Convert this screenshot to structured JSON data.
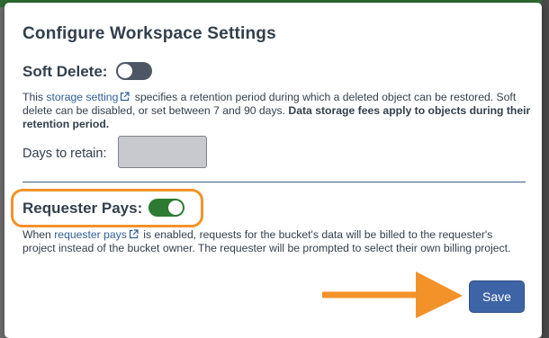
{
  "dialog": {
    "title": "Configure Workspace Settings"
  },
  "soft_delete": {
    "label": "Soft Delete:",
    "enabled": false,
    "desc_prefix": "This ",
    "link_text": "storage setting",
    "desc_middle": " specifies a retention period during which a deleted object can be restored. Soft delete can be disabled, or set between 7 and 90 days. ",
    "desc_bold": "Data storage fees apply to objects during their retention period.",
    "days_label": "Days to retain:",
    "days_value": ""
  },
  "requester_pays": {
    "label": "Requester Pays:",
    "enabled": true,
    "desc_prefix": "When ",
    "link_text": "requester pays",
    "desc_suffix": " is enabled, requests for the bucket's data will be billed to the requester's project instead of the bucket owner. The requester will be prompted to select their own billing project."
  },
  "footer": {
    "save_label": "Save"
  },
  "colors": {
    "toggle_off": "#4d5665",
    "toggle_on": "#2d7a32",
    "link": "#2f5f97",
    "highlight": "#f39229",
    "save_button": "#3d65a6",
    "divider": "#3d5f86"
  },
  "icons": {
    "external_link": "external-link-icon",
    "annotation_arrow": "arrow-right-icon"
  }
}
